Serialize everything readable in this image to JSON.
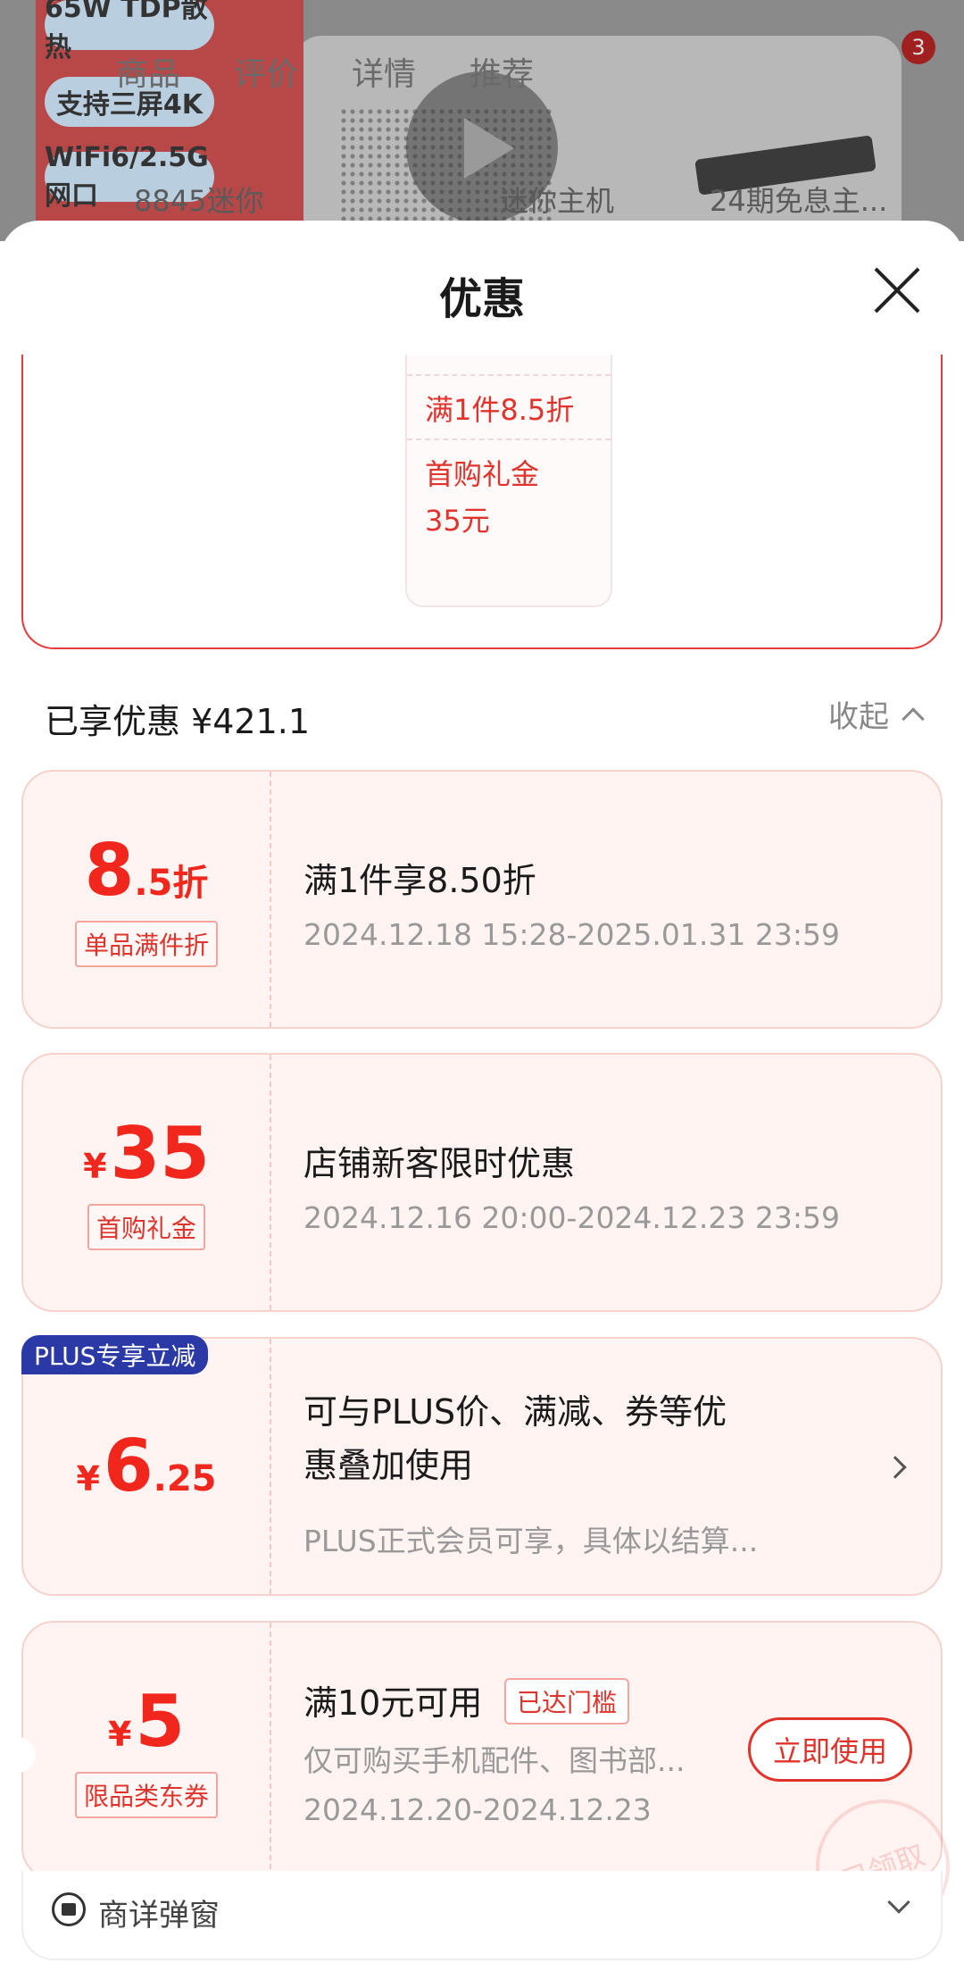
{
  "background_page": {
    "feature_tags": [
      "65W TDP散热",
      "支持三屏4K",
      "WiFi6/2.5G网口"
    ],
    "nav_tabs": [
      "商品",
      "评价",
      "详情",
      "推荐"
    ],
    "cart_badge": "3",
    "search_line": [
      "8845迷你",
      "迷你主机",
      "24期免息主..."
    ]
  },
  "sheet": {
    "title": "优惠",
    "summary_card": {
      "rows": [
        "满1件8.5折",
        "首购礼金",
        "35元"
      ]
    },
    "enjoyed_label": "已享优惠 ¥421.1",
    "collapse_label": "收起"
  },
  "coupons": [
    {
      "amount_big": "8",
      "amount_small": ".5折",
      "tag": "单品满件折",
      "title": "满1件享8.50折",
      "subtitle": "2024.12.18 15:28-2025.01.31 23:59"
    },
    {
      "currency": "¥",
      "amount_big": "35",
      "tag": "首购礼金",
      "title": "店铺新客限时优惠",
      "subtitle": "2024.12.16 20:00-2024.12.23 23:59"
    },
    {
      "badge": "PLUS专享立减",
      "currency": "¥",
      "amount_big": "6",
      "amount_small": ".25",
      "title_line1": "可与PLUS价、满减、券等优",
      "title_line2": "惠叠加使用",
      "subtitle": "PLUS正式会员可享，具体以结算..."
    },
    {
      "currency": "¥",
      "amount_big": "5",
      "tag": "限品类东券",
      "title": "满10元可用",
      "threshold_tag": "已达门槛",
      "subtitle": "仅可购买手机配件、图书部...",
      "date": "2024.12.20-2024.12.23",
      "action": "立即使用",
      "stamp": "已领取"
    }
  ],
  "footer": {
    "label": "商详弹窗"
  },
  "colors": {
    "accent_red": "#e0332b",
    "coupon_bg": "#fff4f2",
    "plus_blue": "#2a39a6"
  }
}
